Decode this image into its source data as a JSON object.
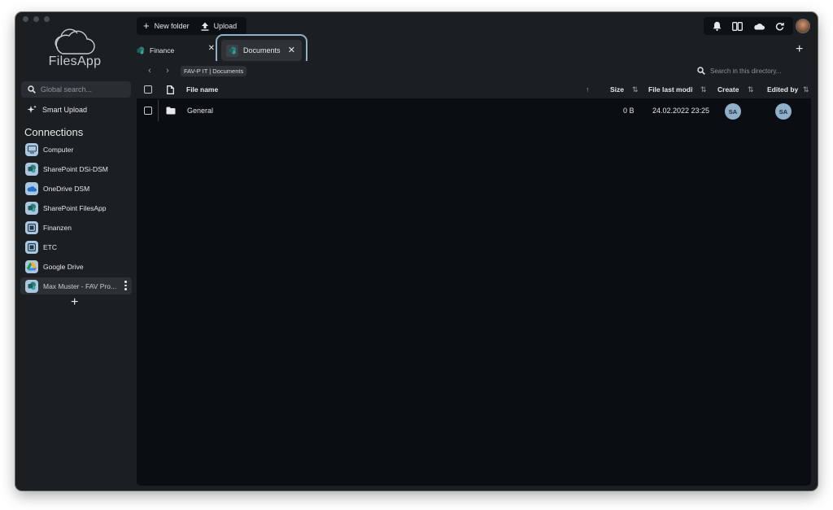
{
  "app": {
    "name": "FilesApp"
  },
  "sidebar": {
    "search_placeholder": "Global search...",
    "smart_upload_label": "Smart Upload",
    "connections_title": "Connections",
    "connections": [
      {
        "label": "Computer",
        "icon": "computer-icon",
        "color": "#a9c7df"
      },
      {
        "label": "SharePoint DSi-DSM",
        "icon": "sharepoint-icon",
        "color": "#a9c7df"
      },
      {
        "label": "OneDrive DSM",
        "icon": "onedrive-icon",
        "color": "#a9c7df"
      },
      {
        "label": "SharePoint FilesApp",
        "icon": "sharepoint-icon",
        "color": "#a9c7df"
      },
      {
        "label": "Finanzen",
        "icon": "drive-icon",
        "color": "#a9c7df"
      },
      {
        "label": "ETC",
        "icon": "drive-icon",
        "color": "#a9c7df"
      },
      {
        "label": "Google Drive",
        "icon": "google-drive-icon",
        "color": "#a9c7df"
      },
      {
        "label": "Max Muster - FAV Pro...",
        "icon": "sharepoint-icon",
        "color": "#a9c7df",
        "active": true
      }
    ]
  },
  "toolbar": {
    "new_folder_label": "New folder",
    "upload_label": "Upload"
  },
  "tabs": [
    {
      "label": "Finance",
      "icon": "sharepoint-icon"
    },
    {
      "label": "Documents",
      "icon": "sharepoint-icon",
      "active": true
    }
  ],
  "path": {
    "breadcrumb": "FAV-P IT | Documents",
    "search_placeholder": "Search in this directory..."
  },
  "table": {
    "columns": {
      "name": "File name",
      "size": "Size",
      "modified": "File last modifi",
      "created": "Create",
      "edited": "Edited by"
    },
    "rows": [
      {
        "name": "General",
        "type": "folder",
        "size": "0 B",
        "modified": "24.02.2022 23:25",
        "created_by": "SA",
        "edited_by": "SA"
      }
    ]
  },
  "colors": {
    "background": "#1c1f22",
    "panel": "#0a0d11",
    "accent": "#8fb0c9"
  }
}
